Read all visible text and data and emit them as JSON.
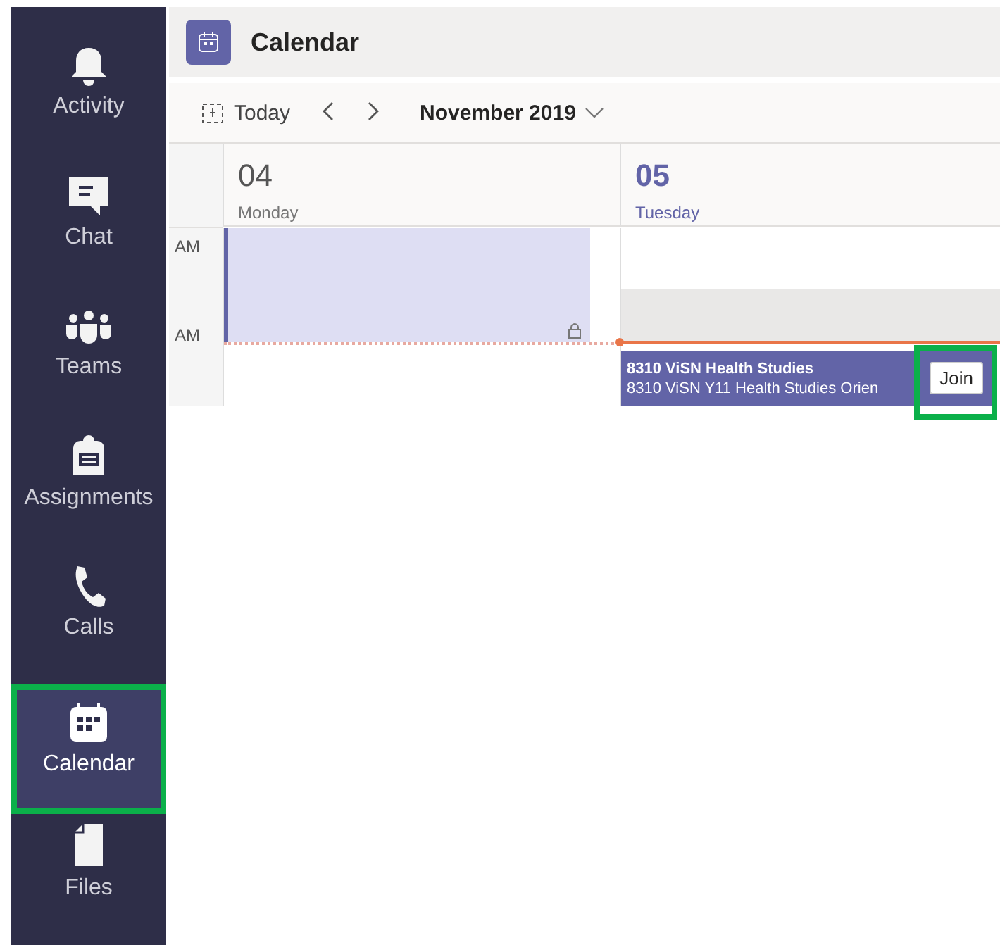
{
  "rail": {
    "items": [
      {
        "label": "Activity",
        "selected": false,
        "highlighted": false
      },
      {
        "label": "Chat",
        "selected": false,
        "highlighted": false
      },
      {
        "label": "Teams",
        "selected": false,
        "highlighted": false
      },
      {
        "label": "Assignments",
        "selected": false,
        "highlighted": false
      },
      {
        "label": "Calls",
        "selected": false,
        "highlighted": false
      },
      {
        "label": "Calendar",
        "selected": true,
        "highlighted": true
      },
      {
        "label": "Files",
        "selected": false,
        "highlighted": false
      }
    ]
  },
  "header": {
    "title": "Calendar"
  },
  "toolbar": {
    "today": "Today",
    "range": "November 2019"
  },
  "times": [
    "AM",
    "AM"
  ],
  "days": [
    {
      "number": "04",
      "name": "Monday",
      "today": false,
      "block": {
        "private": true
      }
    },
    {
      "number": "05",
      "name": "Tuesday",
      "today": true,
      "meeting": {
        "title": "8310 ViSN Health Studies",
        "subtitle": "8310 ViSN Y11 Health Studies Orien",
        "join": {
          "label": "Join",
          "highlighted": true
        }
      }
    }
  ]
}
